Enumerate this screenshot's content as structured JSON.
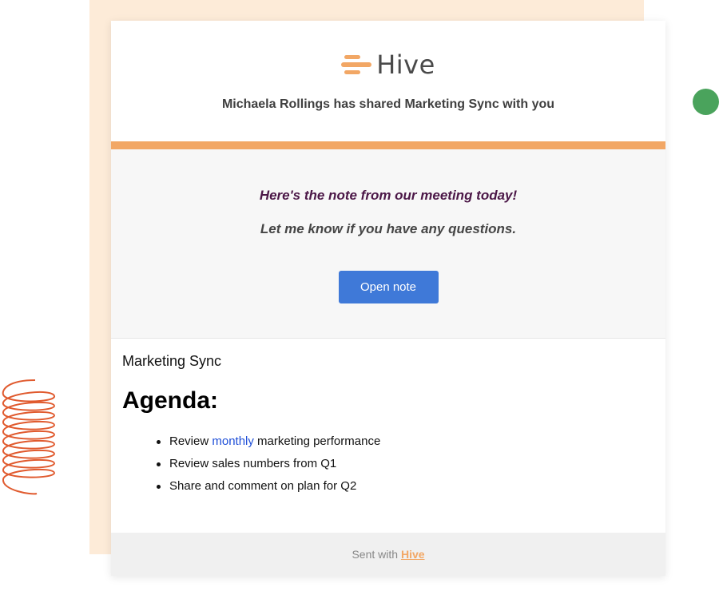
{
  "brand": {
    "name": "Hive",
    "icon": "hive-logo-icon",
    "accent_color": "#f2a765"
  },
  "header": {
    "share_message": "Michaela Rollings has shared Marketing Sync with you"
  },
  "note": {
    "line1": "Here's the note from our meeting today!",
    "line2": "Let me know if you have any questions.",
    "button_label": "Open note",
    "button_color": "#3f79d8"
  },
  "content": {
    "doc_title": "Marketing Sync",
    "heading": "Agenda:",
    "items": [
      {
        "before": "Review ",
        "link": "monthly",
        "after": " marketing performance"
      },
      {
        "text": "Review sales numbers from Q1"
      },
      {
        "text": "Share and comment on plan for Q2"
      }
    ]
  },
  "footer": {
    "prefix": "Sent with ",
    "link": "Hive"
  },
  "decor": {
    "backdrop_color": "#fdebd8",
    "dot_color": "#4aa35c",
    "spring_color": "#e05a2e"
  }
}
